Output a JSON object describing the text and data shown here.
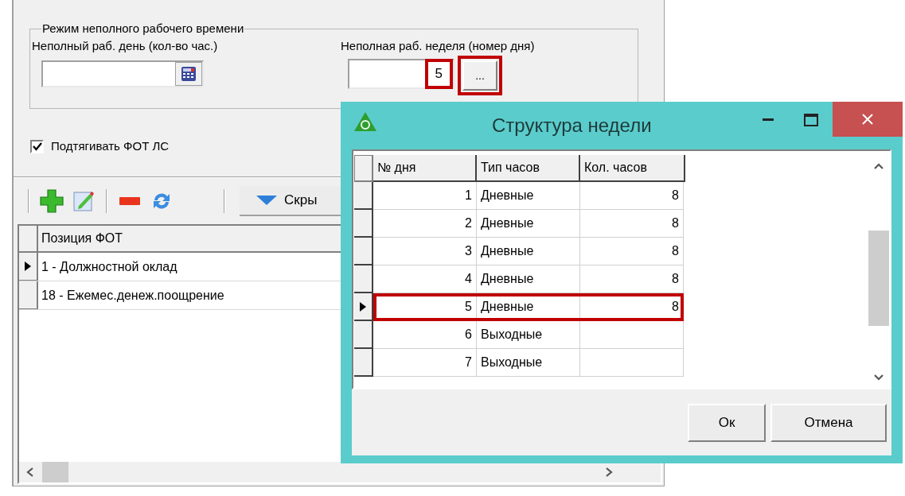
{
  "background_window": {
    "part_time_group": {
      "title": "Режим неполного рабочего времени",
      "part_day": {
        "label": "Неполный раб. день (кол-во час.)"
      },
      "part_week": {
        "label": "Неполная раб. неделя (номер дня)",
        "value": "5",
        "value_highlighted": true,
        "browse_button": "...",
        "button_highlighted": true
      }
    },
    "pull_checkbox": {
      "label": "Подтягивать ФОТ ЛС",
      "checked": true
    },
    "toolbar": {
      "hide_button": "Скры"
    },
    "table": {
      "columns": [
        "Позиция ФОТ"
      ],
      "rows": [
        {
          "cells": [
            "1 - Должностной оклад"
          ],
          "selected": true
        },
        {
          "cells": [
            "18 - Ежемес.денеж.поощрение"
          ],
          "selected": false
        }
      ]
    }
  },
  "dialog": {
    "title": "Структура недели",
    "table": {
      "columns": [
        "№ дня",
        "Тип часов",
        "Кол. часов"
      ],
      "rows": [
        {
          "cells": [
            "1",
            "Дневные",
            "8"
          ],
          "selected": false,
          "highlighted": false
        },
        {
          "cells": [
            "2",
            "Дневные",
            "8"
          ],
          "selected": false,
          "highlighted": false
        },
        {
          "cells": [
            "3",
            "Дневные",
            "8"
          ],
          "selected": false,
          "highlighted": false
        },
        {
          "cells": [
            "4",
            "Дневные",
            "8"
          ],
          "selected": false,
          "highlighted": false
        },
        {
          "cells": [
            "5",
            "Дневные",
            "8"
          ],
          "selected": true,
          "highlighted": true
        },
        {
          "cells": [
            "6",
            "Выходные",
            ""
          ],
          "selected": false,
          "highlighted": false
        },
        {
          "cells": [
            "7",
            "Выходные",
            ""
          ],
          "selected": false,
          "highlighted": false
        }
      ]
    },
    "buttons": [
      "Ок",
      "Отмена"
    ]
  }
}
